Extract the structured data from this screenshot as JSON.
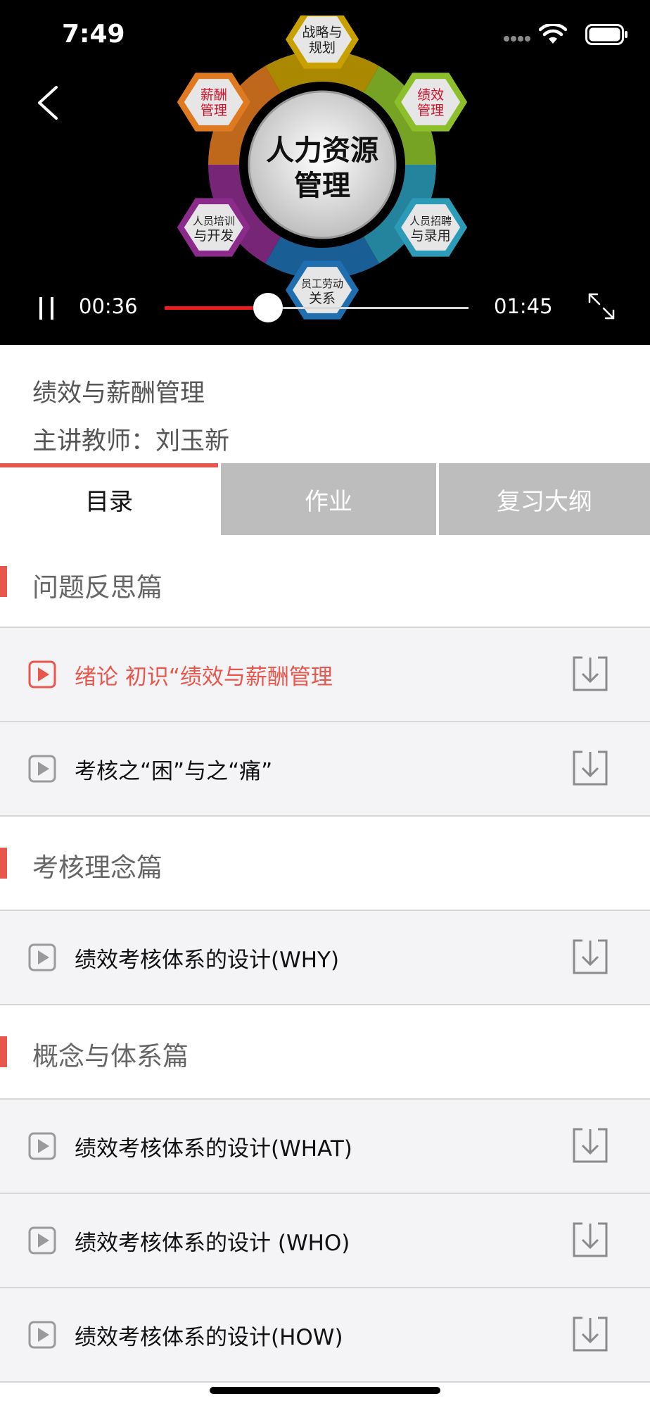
{
  "status_bar": {
    "time": "7:49"
  },
  "player": {
    "current_time": "00:36",
    "duration": "01:45",
    "progress": 0.34,
    "accent": "#ef1c1c",
    "diagram": {
      "center": [
        "人力资源",
        "管理"
      ],
      "nodes": [
        {
          "label": [
            "战略与",
            "规划"
          ],
          "color": "#c8a000",
          "text_color": "#222"
        },
        {
          "label": [
            "绩效",
            "管理"
          ],
          "color": "#8cbf2a",
          "text_color": "#d0102a"
        },
        {
          "label": [
            "人员招聘",
            "与录用"
          ],
          "color": "#2b9bb8",
          "text_color": "#222"
        },
        {
          "label": [
            "员工劳动",
            "关系"
          ],
          "color": "#1f6fb0",
          "text_color": "#222"
        },
        {
          "label": [
            "人员培训",
            "与开发"
          ],
          "color": "#8b2c8c",
          "text_color": "#222"
        },
        {
          "label": [
            "薪酬",
            "管理"
          ],
          "color": "#e07a20",
          "text_color": "#d0102a"
        }
      ]
    }
  },
  "course": {
    "title": "绩效与薪酬管理",
    "teacher": "主讲教师：刘玉新"
  },
  "tabs": [
    {
      "label": "目录",
      "active": true
    },
    {
      "label": "作业",
      "active": false
    },
    {
      "label": "复习大纲",
      "active": false
    }
  ],
  "accent_color": "#e8574d",
  "sections": [
    {
      "title": "问题反思篇",
      "items": [
        {
          "label": "绪论 初识“绩效与薪酬管理",
          "active": true
        },
        {
          "label": "考核之“困”与之“痛”",
          "active": false
        }
      ]
    },
    {
      "title": "考核理念篇",
      "items": [
        {
          "label": "绩效考核体系的设计(WHY)",
          "active": false
        }
      ]
    },
    {
      "title": "概念与体系篇",
      "items": [
        {
          "label": "绩效考核体系的设计(WHAT)",
          "active": false
        },
        {
          "label": "绩效考核体系的设计 (WHO)",
          "active": false
        },
        {
          "label": "绩效考核体系的设计(HOW)",
          "active": false
        }
      ]
    }
  ]
}
